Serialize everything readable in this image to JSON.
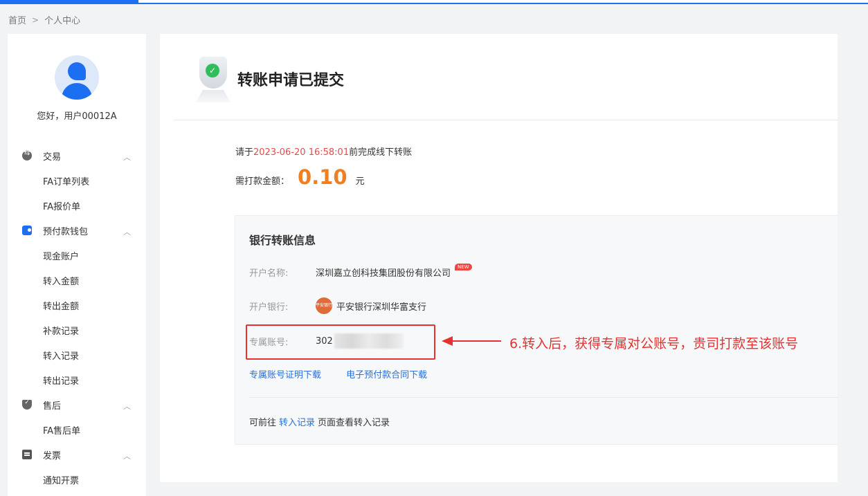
{
  "breadcrumb": {
    "home": "首页",
    "current": "个人中心"
  },
  "user": {
    "greeting": "您好，用户00012A"
  },
  "menu": {
    "trade": {
      "label": "交易",
      "items": [
        "FA订单列表",
        "FA报价单"
      ]
    },
    "wallet": {
      "label": "预付款钱包",
      "items": [
        "现金账户",
        "转入金额",
        "转出金额",
        "补款记录",
        "转入记录",
        "转出记录"
      ]
    },
    "aftersale": {
      "label": "售后",
      "items": [
        "FA售后单"
      ]
    },
    "invoice": {
      "label": "发票",
      "items": [
        "通知开票"
      ]
    }
  },
  "main": {
    "title": "转账申请已提交",
    "deadline_prefix": "请于",
    "deadline_time": "2023-06-20 16:58:01",
    "deadline_suffix": "前完成线下转账",
    "amount_label": "需打款金额：",
    "amount": "0.10",
    "amount_unit": "元",
    "card": {
      "title": "银行转账信息",
      "account_name_label": "开户名称:",
      "account_name": "深圳嘉立创科技集团股份有限公司",
      "badge": "NEW",
      "bank_label": "开户银行:",
      "bank_logo": "平安银行",
      "bank_name": "平安银行深圳华富支行",
      "account_no_label": "专属账号:",
      "account_no": "302",
      "link_certificate": "专属账号证明下载",
      "link_contract": "电子预付款合同下载",
      "footer_prefix": "可前往",
      "footer_link": "转入记录",
      "footer_suffix": "页面查看转入记录"
    }
  },
  "annotation": {
    "text": "6.转入后，获得专属对公账号，贵司打款至该账号"
  },
  "colors": {
    "primary": "#1d6ff2",
    "accent_orange": "#f07f22",
    "alert_red": "#e5312f",
    "link_blue": "#2c6fd6"
  }
}
